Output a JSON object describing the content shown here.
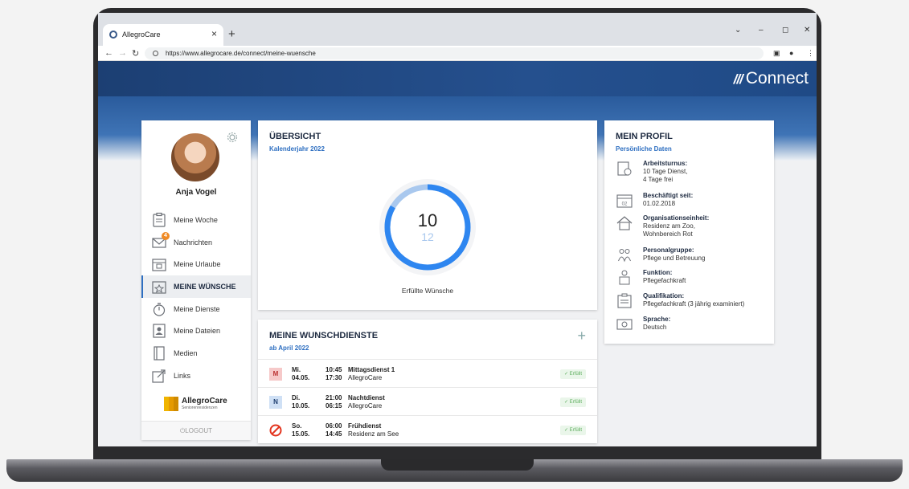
{
  "browser": {
    "tab_title": "AllegroCare",
    "tab_close": "×",
    "new_tab": "+",
    "url": "https://www.allegrocare.de/connect/meine-wuensche",
    "window_controls": [
      "⌄",
      "–",
      "◻",
      "✕"
    ]
  },
  "header": {
    "brand": "Connect",
    "brand_mark": "///"
  },
  "sidebar": {
    "user_name": "Anja Vogel",
    "items": [
      {
        "label": "Meine Woche",
        "icon": "clipboard-icon",
        "active": false
      },
      {
        "label": "Nachrichten",
        "icon": "envelope-icon",
        "active": false,
        "badge": "4"
      },
      {
        "label": "Meine Urlaube",
        "icon": "vacation-calendar-icon",
        "active": false
      },
      {
        "label": "MEINE WÜNSCHE",
        "icon": "star-calendar-icon",
        "active": true
      },
      {
        "label": "Meine Dienste",
        "icon": "stopwatch-icon",
        "active": false
      },
      {
        "label": "Meine Dateien",
        "icon": "portrait-file-icon",
        "active": false
      },
      {
        "label": "Medien",
        "icon": "book-icon",
        "active": false
      },
      {
        "label": "Links",
        "icon": "external-link-icon",
        "active": false
      }
    ],
    "logo_name": "AllegroCare",
    "logo_sub": "Seniorenresidenzen",
    "logout": "LOGOUT"
  },
  "overview": {
    "title": "ÜBERSICHT",
    "subtitle": "Kalenderjahr 2022",
    "fulfilled": 10,
    "total": 12,
    "caption": "Erfüllte Wünsche",
    "ring_color": "#2e86f0",
    "ring_remaining_color": "#a9c8ee"
  },
  "wishes": {
    "title": "MEINE WUNSCHDIENSTE",
    "subtitle": "ab April 2022",
    "add": "+",
    "rows": [
      {
        "badge": "M",
        "badge_bg": "#f6c9c9",
        "badge_fg": "#b33",
        "day": "Mi.",
        "date": "04.05.",
        "start": "10:45",
        "end": "17:30",
        "name": "Mittagsdienst 1",
        "location": "AllegroCare",
        "status": "✓ Erfüllt"
      },
      {
        "badge": "N",
        "badge_bg": "#cfe0f5",
        "badge_fg": "#1d3d6e",
        "day": "Di.",
        "date": "10.05.",
        "start": "21:00",
        "end": "06:15",
        "name": "Nachtdienst",
        "location": "AllegroCare",
        "status": "✓ Erfüllt"
      },
      {
        "badge": "no-entry-icon",
        "badge_bg": "",
        "badge_fg": "#e3341e",
        "day": "So.",
        "date": "15.05.",
        "start": "06:00",
        "end": "14:45",
        "name": "Frühdienst",
        "location": "Residenz am See",
        "status": "✓ Erfüllt"
      }
    ]
  },
  "profile": {
    "title": "MEIN PROFIL",
    "subtitle": "Persönliche Daten",
    "rows": [
      {
        "label": "Arbeitsturnus:",
        "line1": "10 Tage Dienst,",
        "line2": "4 Tage frei",
        "icon": "calendar-cycle-icon"
      },
      {
        "label": "Beschäftigt seit:",
        "line1": "01.02.2018",
        "line2": "",
        "icon": "calendar-date-icon"
      },
      {
        "label": "Organisationseinheit:",
        "line1": "Residenz am Zoo,",
        "line2": "Wohnbereich Rot",
        "icon": "house-icon"
      },
      {
        "label": "Personalgruppe:",
        "line1": "Pflege und Betreuung",
        "line2": "",
        "icon": "group-icon"
      },
      {
        "label": "Funktion:",
        "line1": "Pflegefachkraft",
        "line2": "",
        "icon": "person-badge-icon"
      },
      {
        "label": "Qualifikation:",
        "line1": "Pflegefachkraft (3 jährig examiniert)",
        "line2": "",
        "icon": "certificate-icon"
      },
      {
        "label": "Sprache:",
        "line1": "Deutsch",
        "line2": "",
        "icon": "speech-icon"
      }
    ]
  }
}
